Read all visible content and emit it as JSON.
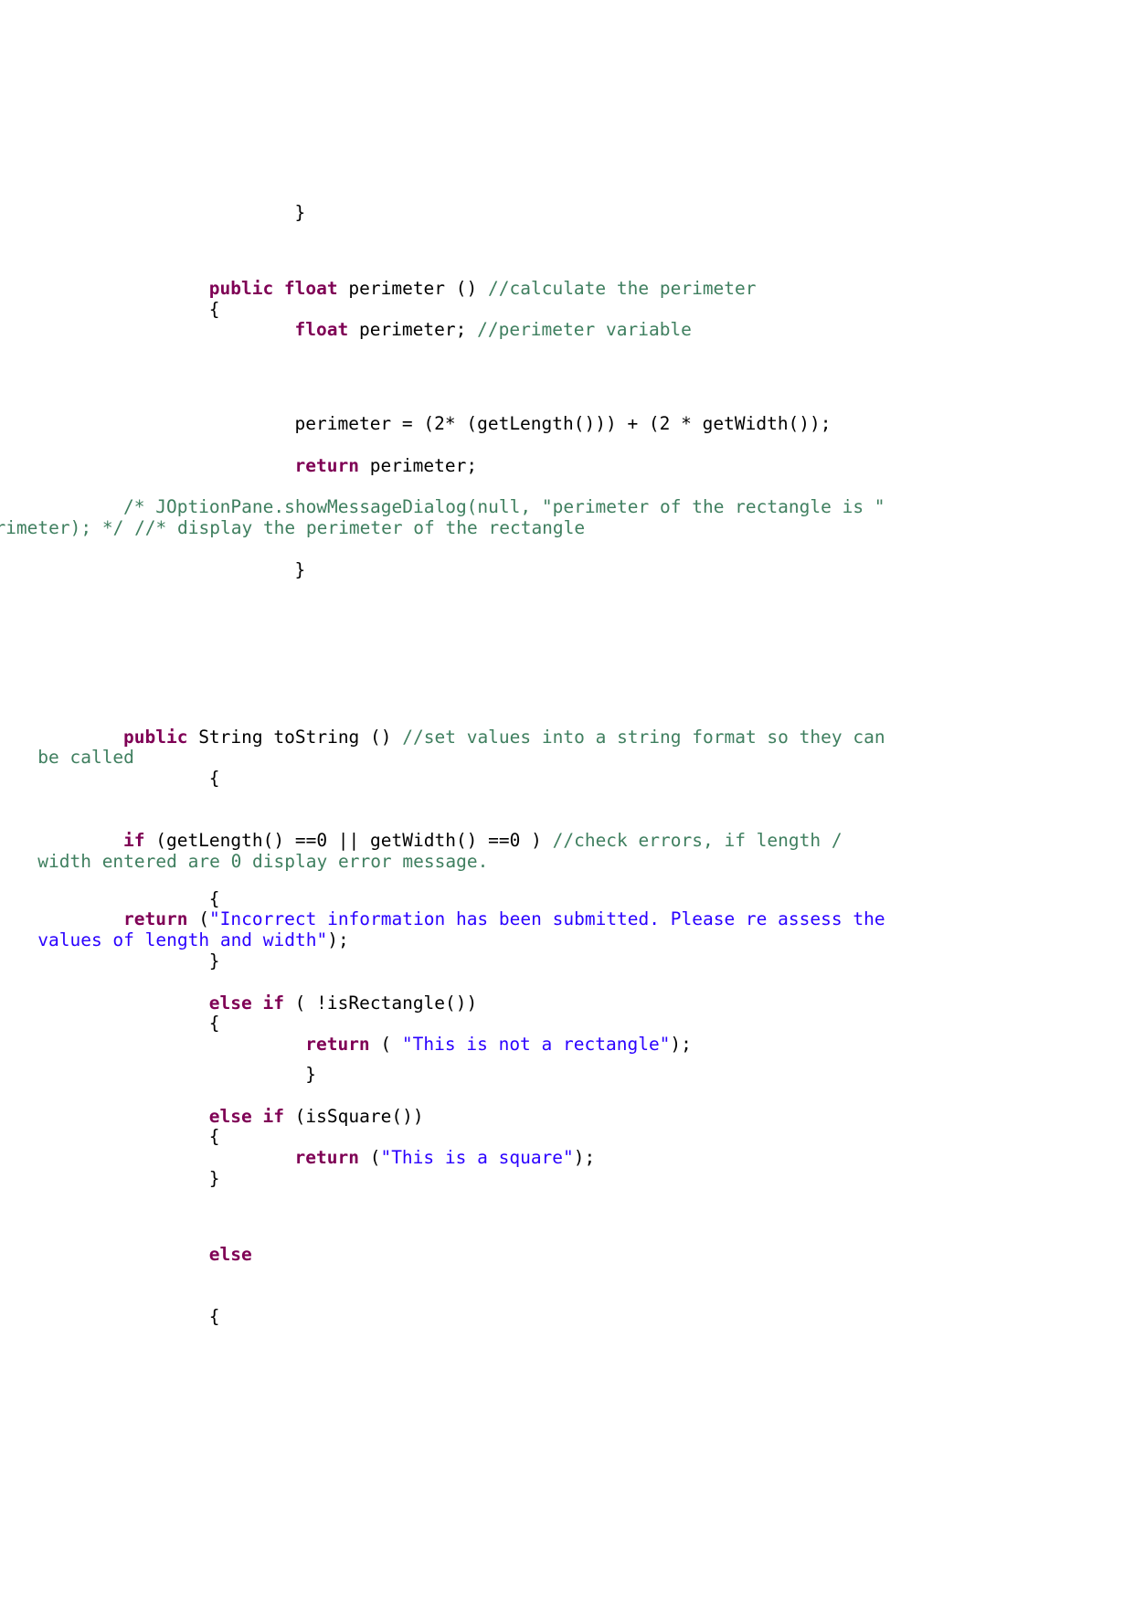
{
  "document": {
    "type": "java-source-code-listing",
    "language": "Java",
    "theme": {
      "background": "#ffffff",
      "keyword_color": "#7f0055",
      "comment_color": "#3f7f5f",
      "string_color": "#2a00ff",
      "plain_color": "#000000"
    }
  },
  "code": {
    "lines": [
      {
        "id": "line-close-brace-1",
        "indent": 16,
        "segments": [
          {
            "kind": "plain",
            "text": "}"
          }
        ]
      },
      {
        "id": "line-spacer-1",
        "spacer": "sp-60",
        "segments": []
      },
      {
        "id": "line-perimeter-signature",
        "indent": 8,
        "segments": [
          {
            "kind": "kw",
            "text": "public float"
          },
          {
            "kind": "plain",
            "text": " perimeter () "
          },
          {
            "kind": "cmt",
            "text": "//calculate the perimeter"
          }
        ]
      },
      {
        "id": "line-perimeter-open-brace",
        "indent": 8,
        "segments": [
          {
            "kind": "plain",
            "text": "{"
          }
        ]
      },
      {
        "id": "line-perimeter-declare",
        "indent": 16,
        "segments": [
          {
            "kind": "kw",
            "text": "float"
          },
          {
            "kind": "plain",
            "text": " perimeter; "
          },
          {
            "kind": "cmt",
            "text": "//perimeter variable"
          }
        ]
      },
      {
        "id": "line-spacer-2",
        "spacer": "sp-78",
        "segments": []
      },
      {
        "id": "line-perimeter-formula",
        "indent": 16,
        "segments": [
          {
            "kind": "plain",
            "text": "perimeter = (2* (getLength())) + (2 * getWidth());"
          }
        ]
      },
      {
        "id": "line-spacer-3",
        "spacer": "sp-22",
        "segments": []
      },
      {
        "id": "line-return-perimeter",
        "indent": 16,
        "segments": [
          {
            "kind": "kw",
            "text": "return"
          },
          {
            "kind": "plain",
            "text": " perimeter;"
          }
        ]
      },
      {
        "id": "line-spacer-4",
        "spacer": "sp-22",
        "segments": []
      },
      {
        "id": "line-joptionpane-comment",
        "indent": 16,
        "hanging": true,
        "segments": [
          {
            "kind": "cmt",
            "text": "/* JOptionPane.showMessageDialog(null, \"perimeter of the rectangle is \" + perimeter); */ //* display the perimeter of the rectangle"
          }
        ]
      },
      {
        "id": "line-spacer-5",
        "spacer": "sp-22",
        "segments": []
      },
      {
        "id": "line-perimeter-close-brace",
        "indent": 16,
        "segments": [
          {
            "kind": "plain",
            "text": "}"
          }
        ]
      },
      {
        "id": "line-spacer-6",
        "spacer": "sp-78",
        "segments": []
      },
      {
        "id": "line-spacer-7",
        "spacer": "sp-78",
        "segments": []
      },
      {
        "id": "line-tostring-signature",
        "indent": 8,
        "hanging": true,
        "segments": [
          {
            "kind": "kw",
            "text": "public"
          },
          {
            "kind": "plain",
            "text": " String toString () "
          },
          {
            "kind": "cmt",
            "text": "//set values into a string format so they can be called"
          }
        ]
      },
      {
        "id": "line-tostring-open-brace",
        "indent": 8,
        "segments": [
          {
            "kind": "plain",
            "text": "{"
          }
        ]
      },
      {
        "id": "line-spacer-8",
        "spacer": "sp-44",
        "segments": []
      },
      {
        "id": "line-if-check-errors",
        "indent": 8,
        "hanging": true,
        "segments": [
          {
            "kind": "kw",
            "text": "if"
          },
          {
            "kind": "plain",
            "text": " (getLength() ==0 || getWidth() ==0 ) "
          },
          {
            "kind": "cmt",
            "text": "//check errors, if length / width entered are 0 display error message."
          }
        ]
      },
      {
        "id": "line-spacer-9",
        "spacer": "sp-18",
        "segments": []
      },
      {
        "id": "line-if-open-brace",
        "indent": 8,
        "segments": [
          {
            "kind": "plain",
            "text": "{"
          }
        ]
      },
      {
        "id": "line-return-incorrect",
        "indent": 8,
        "hanging": true,
        "segments": [
          {
            "kind": "kw",
            "text": "return"
          },
          {
            "kind": "plain",
            "text": " ("
          },
          {
            "kind": "str",
            "text": "\"Incorrect information has been submitted. Please re assess the values of length and width\""
          },
          {
            "kind": "plain",
            "text": ");"
          }
        ]
      },
      {
        "id": "line-if-close-brace",
        "indent": 8,
        "segments": [
          {
            "kind": "plain",
            "text": "}"
          }
        ]
      },
      {
        "id": "line-spacer-10",
        "spacer": "sp-22",
        "segments": []
      },
      {
        "id": "line-elseif-isrectangle",
        "indent": 8,
        "segments": [
          {
            "kind": "kw",
            "text": "else if"
          },
          {
            "kind": "plain",
            "text": " ( !isRectangle())"
          }
        ]
      },
      {
        "id": "line-elseif-rect-open-brace",
        "indent": 8,
        "segments": [
          {
            "kind": "plain",
            "text": "{"
          }
        ]
      },
      {
        "id": "line-return-not-rectangle",
        "indent": 17,
        "segments": [
          {
            "kind": "kw",
            "text": "return"
          },
          {
            "kind": "plain",
            "text": " ( "
          },
          {
            "kind": "str",
            "text": "\"This is not a rectangle\""
          },
          {
            "kind": "plain",
            "text": ");"
          }
        ]
      },
      {
        "id": "line-spacer-11",
        "spacer": "sp-10",
        "segments": []
      },
      {
        "id": "line-elseif-rect-close-brace",
        "indent": 17,
        "segments": [
          {
            "kind": "plain",
            "text": "}"
          }
        ]
      },
      {
        "id": "line-spacer-12",
        "spacer": "sp-22",
        "segments": []
      },
      {
        "id": "line-elseif-issquare",
        "indent": 8,
        "segments": [
          {
            "kind": "kw",
            "text": "else if"
          },
          {
            "kind": "plain",
            "text": " (isSquare())"
          }
        ]
      },
      {
        "id": "line-elseif-square-open-brace",
        "indent": 8,
        "segments": [
          {
            "kind": "plain",
            "text": "{"
          }
        ]
      },
      {
        "id": "line-return-square",
        "indent": 16,
        "segments": [
          {
            "kind": "kw",
            "text": "return"
          },
          {
            "kind": "plain",
            "text": " ("
          },
          {
            "kind": "str",
            "text": "\"This is a square\""
          },
          {
            "kind": "plain",
            "text": ");"
          }
        ]
      },
      {
        "id": "line-elseif-square-close-brace",
        "indent": 8,
        "segments": [
          {
            "kind": "plain",
            "text": "}"
          }
        ]
      },
      {
        "id": "line-spacer-13",
        "spacer": "sp-60",
        "segments": []
      },
      {
        "id": "line-else",
        "indent": 8,
        "segments": [
          {
            "kind": "kw",
            "text": "else"
          }
        ]
      },
      {
        "id": "line-spacer-14",
        "spacer": "sp-44",
        "segments": []
      },
      {
        "id": "line-else-open-brace",
        "indent": 8,
        "segments": [
          {
            "kind": "plain",
            "text": "{"
          }
        ]
      }
    ]
  }
}
